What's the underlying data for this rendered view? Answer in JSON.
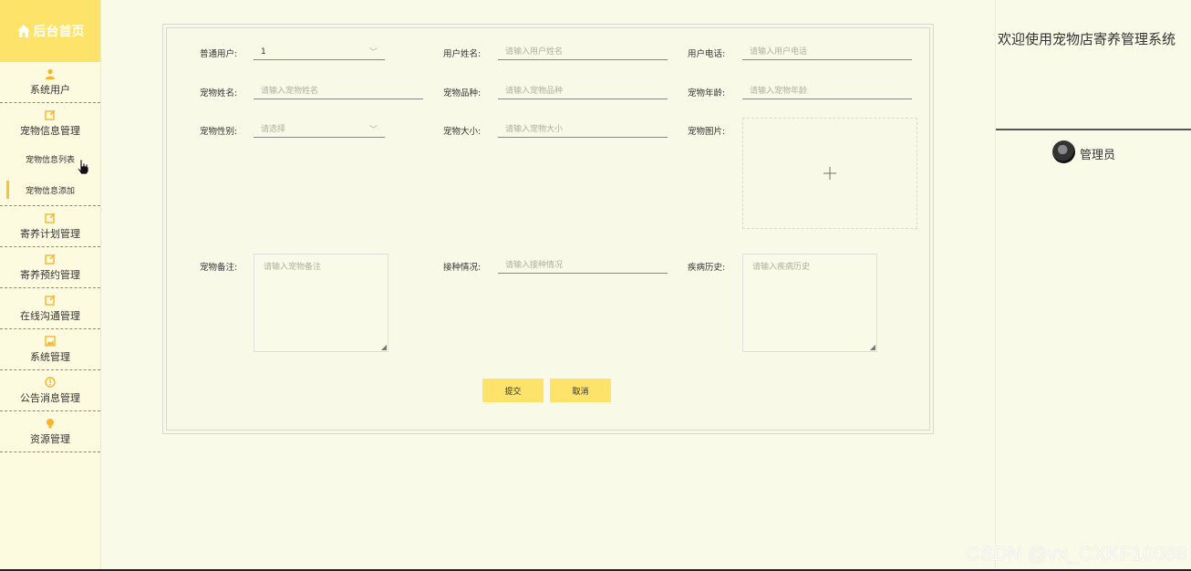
{
  "sidebar": {
    "home_label": "后台首页",
    "items": [
      {
        "label": "系统用户",
        "icon": "user-icon"
      },
      {
        "label": "宠物信息管理",
        "icon": "edit-icon"
      },
      {
        "label": "寄养计划管理",
        "icon": "edit-icon"
      },
      {
        "label": "寄养预约管理",
        "icon": "edit-icon"
      },
      {
        "label": "在线沟通管理",
        "icon": "edit-icon"
      },
      {
        "label": "系统管理",
        "icon": "image-icon"
      },
      {
        "label": "公告消息管理",
        "icon": "info-icon"
      },
      {
        "label": "资源管理",
        "icon": "bulb-icon"
      }
    ],
    "subitems": [
      {
        "label": "宠物信息列表"
      },
      {
        "label": "宠物信息添加"
      }
    ],
    "accent": "#fde36a"
  },
  "header": {
    "welcome": "欢迎使用宠物店寄养管理系统",
    "admin_name": "管理员"
  },
  "form": {
    "user_label": "普通用户:",
    "user_value": "1",
    "user_name_label": "用户姓名:",
    "user_name_placeholder": "请输入用户姓名",
    "user_phone_label": "用户电话:",
    "user_phone_placeholder": "请输入用户电话",
    "pet_name_label": "宠物姓名:",
    "pet_name_placeholder": "请输入宠物姓名",
    "pet_breed_label": "宠物品种:",
    "pet_breed_placeholder": "请输入宠物品种",
    "pet_age_label": "宠物年龄:",
    "pet_age_placeholder": "请输入宠物年龄",
    "pet_gender_label": "宠物性别:",
    "pet_gender_placeholder": "请选择",
    "pet_size_label": "宠物大小:",
    "pet_size_placeholder": "请输入宠物大小",
    "pet_image_label": "宠物图片:",
    "pet_note_label": "宠物备注:",
    "pet_note_placeholder": "请输入宠物备注",
    "vaccine_label": "接种情况:",
    "vaccine_placeholder": "请输入接种情况",
    "disease_label": "疾病历史:",
    "disease_placeholder": "请输入疾病历史",
    "submit_label": "提交",
    "cancel_label": "取消"
  },
  "watermark": "CSDN @vx_CXKF10088"
}
